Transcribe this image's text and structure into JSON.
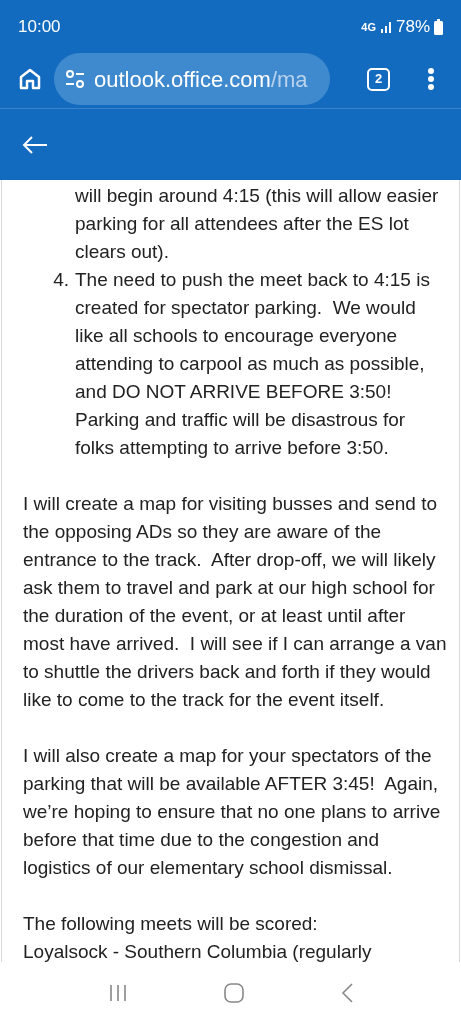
{
  "status_bar": {
    "time": "10:00",
    "network": "4G",
    "battery": "78%"
  },
  "browser": {
    "url_main": "outlook.office.com",
    "url_rest": "/ma",
    "tab_count": "2"
  },
  "body": [
    {
      "kind": "continuation",
      "text": "will begin around 4:15 (this will allow easier parking for all attendees after the ES lot clears out)."
    },
    {
      "kind": "list_item",
      "marker": "4.",
      "text": "The need to push the meet back to 4:15 is created for spectator parking.  We would like all schools to encourage everyone attending to carpool as much as possible, and DO NOT ARRIVE BEFORE 3:50!  Parking and traffic will be disastrous for folks attempting to arrive before 3:50."
    },
    {
      "kind": "paragraph",
      "text": "I will create a map for visiting busses and send to the opposing ADs so they are aware of the entrance to the track.  After drop-off, we will likely ask them to travel and park at our high school for the duration of the event, or at least until after most have arrived.  I will see if I can arrange a van to shuttle the drivers back and forth if they would like to come to the track for the event itself."
    },
    {
      "kind": "paragraph",
      "text": "I will also create a map for your spectators of the parking that will be available AFTER 3:45!  Again, we’re hoping to ensure that no one plans to arrive before that time due to the congestion and logistics of our elementary school dismissal."
    },
    {
      "kind": "paragraph",
      "text": "The following meets will be scored:"
    },
    {
      "kind": "line",
      "text": "Loyalsock - Southern Columbia (regularly"
    }
  ]
}
